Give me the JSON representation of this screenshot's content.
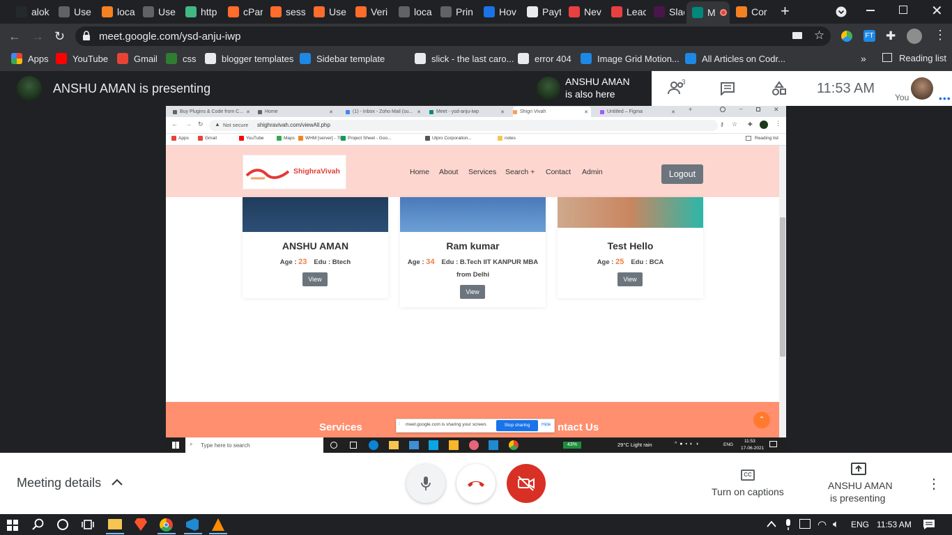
{
  "browser": {
    "tabs": [
      {
        "label": "alok",
        "color": "#24292e"
      },
      {
        "label": "Use",
        "color": "#5f6368"
      },
      {
        "label": "loca",
        "color": "#f58220"
      },
      {
        "label": "Use",
        "color": "#5f6368"
      },
      {
        "label": "http",
        "color": "#42b883"
      },
      {
        "label": "cPar",
        "color": "#ff6c2c"
      },
      {
        "label": "sess",
        "color": "#ff6c2c"
      },
      {
        "label": "Use",
        "color": "#ff6c2c"
      },
      {
        "label": "Veri",
        "color": "#ff6c2c"
      },
      {
        "label": "loca",
        "color": "#5f6368"
      },
      {
        "label": "Prin",
        "color": "#5f6368"
      },
      {
        "label": "Hov",
        "color": "#1a73e8"
      },
      {
        "label": "Payt",
        "color": "#e8eaed"
      },
      {
        "label": "Nev",
        "color": "#e84040"
      },
      {
        "label": "Leac",
        "color": "#e84040"
      },
      {
        "label": "Slac",
        "color": "#4a154b"
      },
      {
        "label": "M",
        "color": "#00897b"
      },
      {
        "label": "Cor",
        "color": "#f48024"
      }
    ],
    "url": "meet.google.com/ysd-anju-iwp",
    "bookmarks": [
      {
        "label": "Apps",
        "color": "#ea4335"
      },
      {
        "label": "YouTube",
        "color": "#ff0000"
      },
      {
        "label": "Gmail",
        "color": "#ea4335"
      },
      {
        "label": "css",
        "color": "#2e7d32"
      },
      {
        "label": "blogger templates",
        "color": "#e8eaed"
      },
      {
        "label": "Sidebar template",
        "color": "#1e88e5"
      },
      {
        "label": "slick - the last caro...",
        "color": "#e8eaed"
      },
      {
        "label": "error 404",
        "color": "#e8eaed"
      },
      {
        "label": "Image Grid Motion...",
        "color": "#1e88e5"
      },
      {
        "label": "All Articles on Codr...",
        "color": "#1e88e5"
      }
    ],
    "reading_list": "Reading list"
  },
  "meet": {
    "presenting_title": "ANSHU AMAN is presenting",
    "also_here_name": "ANSHU AMAN",
    "also_here_text": "is also here",
    "participants_count": "3",
    "time": "11:53  AM",
    "you_label": "You",
    "meeting_details": "Meeting details",
    "captions_label": "Turn on captions",
    "presenter_name": "ANSHU AMAN",
    "presenter_status": "is presenting"
  },
  "shared": {
    "tabs": [
      "Buy Plugins & Code from C...",
      "Home",
      "(1) - Inbox - Zoho Mail (su...",
      "Meet - ysd-anju-iwp",
      "Shigri Vivah",
      "Untitled – Figma"
    ],
    "not_secure": "Not secure",
    "url": "shighravivah.com/viewAll.php",
    "bookmarks": [
      "Apps",
      "Gmail",
      "YouTube",
      "Maps",
      "WHM [server] - 78...",
      "Project Sheet - Goo...",
      "Ulpro Corporation...",
      "notes"
    ],
    "reading_list": "Reading list",
    "site": {
      "logo": "ShighraVivah",
      "nav": [
        "Home",
        "About",
        "Services",
        "Search +",
        "Contact",
        "Admin"
      ],
      "logout": "Logout",
      "cards": [
        {
          "name": "ANSHU AMAN",
          "age_label": "Age :",
          "age": "23",
          "edu": "Edu : Btech",
          "edu2": "",
          "button": "View"
        },
        {
          "name": "Ram kumar",
          "age_label": "Age :",
          "age": "34",
          "edu": "Edu : B.Tech IIT KANPUR MBA",
          "edu2": "from Delhi",
          "button": "View"
        },
        {
          "name": "Test Hello",
          "age_label": "Age :",
          "age": "25",
          "edu": "Edu : BCA",
          "edu2": "",
          "button": "View"
        }
      ],
      "footer_left": "Services",
      "footer_right": "ntact Us"
    },
    "sharing_bar": {
      "text": "meet.google.com is sharing your screen.",
      "stop": "Stop sharing",
      "hide": "Hide"
    },
    "taskbar": {
      "search": "Type here to search",
      "battery": "43%",
      "weather": "29°C  Light rain",
      "lang": "ENG",
      "time": "11:53",
      "date": "17-06-2021"
    }
  },
  "windows": {
    "lang": "ENG",
    "time": "11:53 AM"
  }
}
